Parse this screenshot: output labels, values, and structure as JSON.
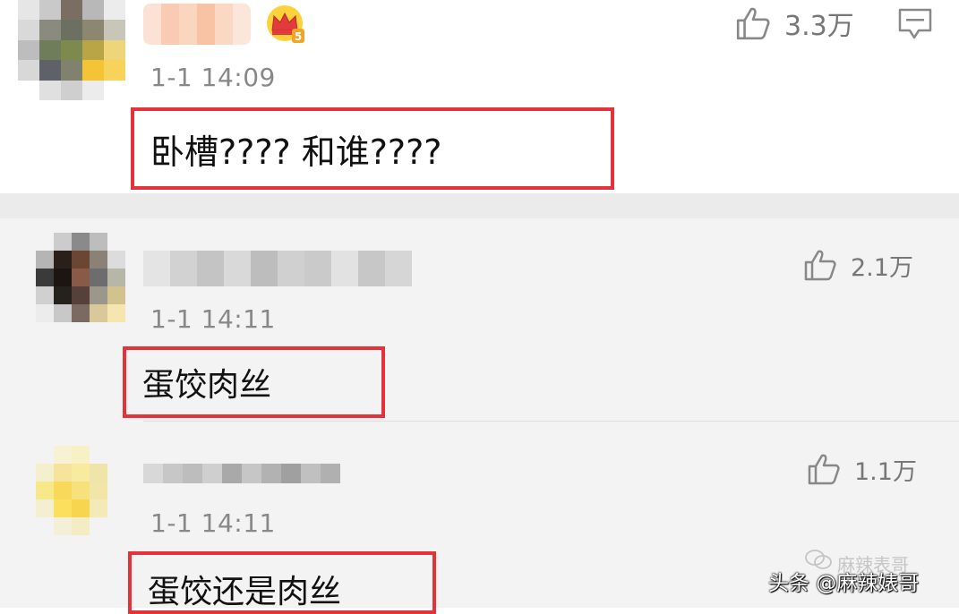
{
  "comments": [
    {
      "timestamp": "1-1 14:09",
      "likes": "3.3万",
      "text": "卧槽???? 和谁????",
      "badge_icon": "crown-level-icon",
      "avatar_colors": [
        "#e6e6e6",
        "#c9c9c9",
        "#7a6e63",
        "#b8b8b8",
        "#ececec",
        "#d9d9d9",
        "#8a8a7e",
        "#6b7060",
        "#8d8670",
        "#c8c6b8",
        "#bdbdbd",
        "#6f7d5a",
        "#7d8a4e",
        "#b8a646",
        "#efd57a",
        "#d8d8d8",
        "#5e6268",
        "#80826e",
        "#f4c336",
        "#f7d35a",
        "#ffffff",
        "#e0e0e0",
        "#cfcfcf",
        "#ececec",
        "#ffffff"
      ],
      "name_colors": [
        "#fbe2d4",
        "#f9cbb2",
        "#fbd6bf",
        "#f8c2a4",
        "#fbd8c4",
        "#fce6da"
      ]
    },
    {
      "timestamp": "1-1 14:11",
      "likes": "2.1万",
      "text": "蛋饺肉丝",
      "avatar_colors": [
        "#f3f3f3",
        "#cccccc",
        "#8a8a8a",
        "#bdbdbd",
        "#f3f3f3",
        "#b5b5b5",
        "#2a2019",
        "#6b4635",
        "#8a8276",
        "#dcdcdc",
        "#3a3a3a",
        "#1c1511",
        "#8a5a48",
        "#6d6d6d",
        "#b7b7a8",
        "#d0d0d0",
        "#25211d",
        "#56413a",
        "#9b978a",
        "#d2c28e",
        "#ececec",
        "#c8c8c8",
        "#7a6a62",
        "#d8c89a",
        "#f5e6b0"
      ],
      "name_colors": [
        "#e4e4e4",
        "#d2d2d2",
        "#c4c4c4",
        "#d9d9d9",
        "#bdbdbd",
        "#d0d0d0",
        "#cacaca",
        "#e2e2e2",
        "#c7c7c7",
        "#d6d6d6"
      ]
    },
    {
      "timestamp": "1-1 14:11",
      "likes": "1.1万",
      "text": "蛋饺还是肉丝",
      "avatar_colors": [
        "#f3f3f3",
        "#f7f2d4",
        "#f8f1c6",
        "#f3f3f3",
        "#f3f3f3",
        "#f4efcc",
        "#f6e49a",
        "#f8ea9e",
        "#efe5a8",
        "#f3f3f3",
        "#f7e88a",
        "#f9d95a",
        "#f7e17c",
        "#f1e6a8",
        "#f3f3f3",
        "#f3efd0",
        "#fbe05e",
        "#f8d54e",
        "#f3eab8",
        "#f3f3f3",
        "#f3f3f3",
        "#f4efd8",
        "#f3ecc4",
        "#f3f3f3",
        "#f3f3f3"
      ],
      "name_colors": [
        "#d8d8d8",
        "#c7c7c7",
        "#bdbdbd",
        "#cfcfcf",
        "#a9a9a9",
        "#c6c6c6",
        "#b2b2b2",
        "#a0a0a0",
        "#c0c0c0",
        "#b0b0b0"
      ]
    }
  ],
  "watermark": {
    "text": "头条 @麻辣婊哥",
    "logo_text": "麻辣表哥",
    "logo_icon": "wechat-icon"
  },
  "colors": {
    "highlight_box": "#e3323a",
    "reply_background": "#f3f3f3",
    "separator": "#ebebeb"
  }
}
